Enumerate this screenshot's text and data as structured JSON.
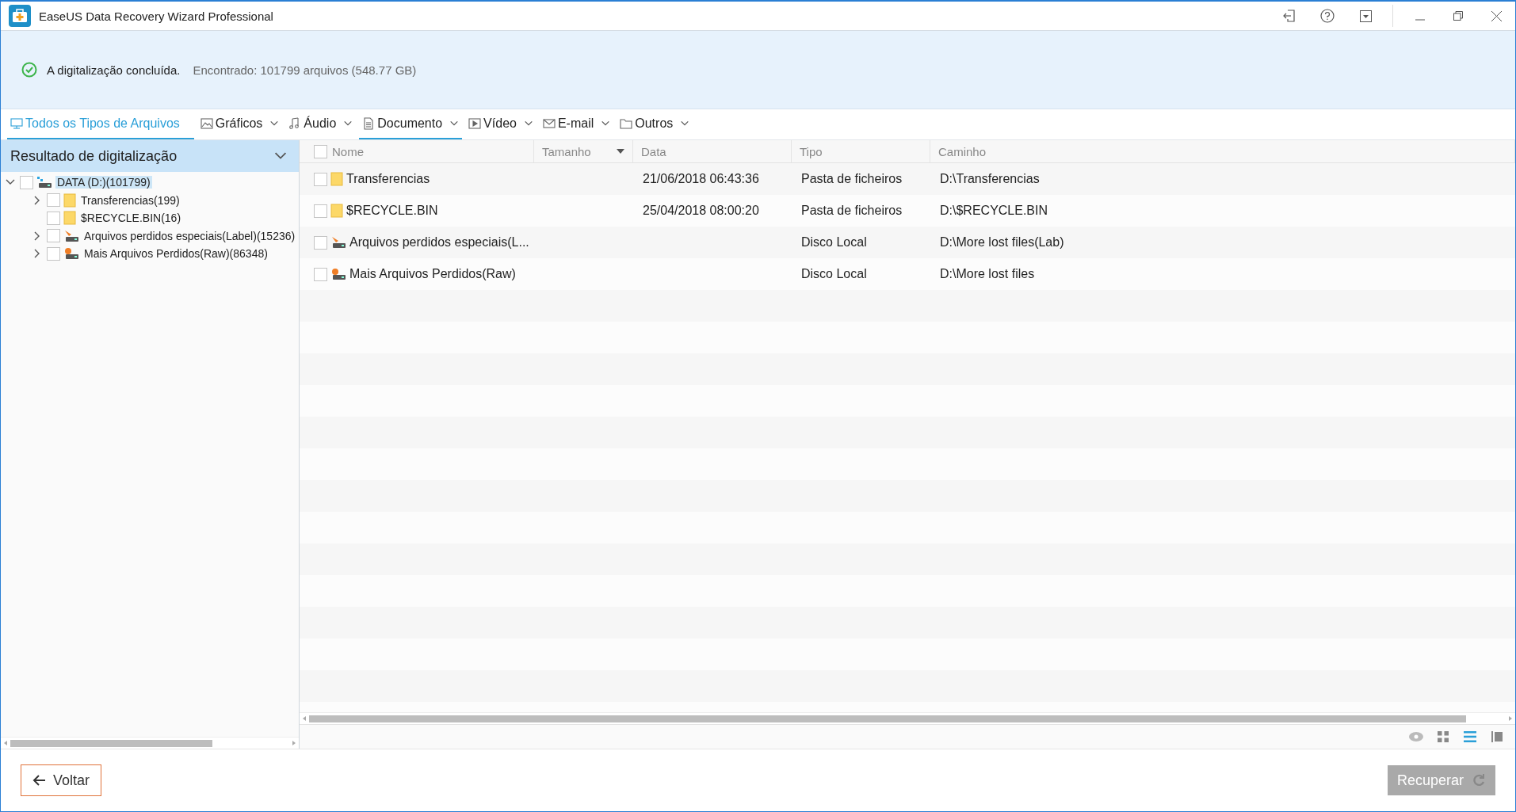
{
  "window": {
    "title": "EaseUS Data Recovery Wizard Professional"
  },
  "status": {
    "message": "A digitalização concluída.",
    "found": "Encontrado: 101799 arquivos (548.77 GB)"
  },
  "tabs": [
    {
      "label": "Todos os Tipos de Arquivos",
      "kind": "monitor",
      "selected": true,
      "underlined": true,
      "dropdown": false
    },
    {
      "label": "Gráficos",
      "kind": "image",
      "selected": false,
      "underlined": false,
      "dropdown": true
    },
    {
      "label": "Áudio",
      "kind": "music",
      "selected": false,
      "underlined": false,
      "dropdown": true
    },
    {
      "label": "Documento",
      "kind": "document",
      "selected": false,
      "underlined": true,
      "dropdown": true
    },
    {
      "label": "Vídeo",
      "kind": "video",
      "selected": false,
      "underlined": false,
      "dropdown": true
    },
    {
      "label": "E-mail",
      "kind": "mail",
      "selected": false,
      "underlined": false,
      "dropdown": true
    },
    {
      "label": "Outros",
      "kind": "folder",
      "selected": false,
      "underlined": false,
      "dropdown": true
    }
  ],
  "sidebar": {
    "title": "Resultado de digitalização",
    "tree": [
      {
        "label": "DATA (D:)(101799)",
        "kind": "drive",
        "checked": false,
        "selected": true,
        "expandable": true,
        "expanded": true,
        "children": [
          {
            "label": "Transferencias(199)",
            "kind": "folder",
            "checked": false,
            "selected": false,
            "expandable": true,
            "expanded": false
          },
          {
            "label": "$RECYCLE.BIN(16)",
            "kind": "folder",
            "checked": false,
            "selected": false,
            "expandable": false
          },
          {
            "label": "Arquivos perdidos especiais(Label)(15236)",
            "kind": "lost-drive",
            "checked": false,
            "selected": false,
            "expandable": true,
            "expanded": false
          },
          {
            "label": "Mais Arquivos Perdidos(Raw)(86348)",
            "kind": "raw-drive",
            "checked": false,
            "selected": false,
            "expandable": true,
            "expanded": false
          }
        ]
      }
    ]
  },
  "table": {
    "all_checked": false,
    "columns": [
      {
        "label": "Nome",
        "sorted": false
      },
      {
        "label": "Tamanho",
        "sorted": true
      },
      {
        "label": "Data",
        "sorted": false
      },
      {
        "label": "Tipo",
        "sorted": false
      },
      {
        "label": "Caminho",
        "sorted": false
      }
    ],
    "rows": [
      {
        "checked": false,
        "kind": "folder",
        "name": "Transferencias",
        "date": "21/06/2018 06:43:36",
        "type": "Pasta de ficheiros",
        "path": "D:\\Transferencias"
      },
      {
        "checked": false,
        "kind": "folder",
        "name": "$RECYCLE.BIN",
        "date": "25/04/2018 08:00:20",
        "type": "Pasta de ficheiros",
        "path": "D:\\$RECYCLE.BIN"
      },
      {
        "checked": false,
        "kind": "lost-drive",
        "name": "Arquivos perdidos especiais(L...",
        "type": "Disco Local",
        "path": "D:\\More lost files(Lab)"
      },
      {
        "checked": false,
        "kind": "raw-drive",
        "name": "Mais Arquivos Perdidos(Raw)",
        "type": "Disco Local",
        "path": "D:\\More lost files"
      }
    ]
  },
  "view_modes": [
    {
      "kind": "preview",
      "selected": false
    },
    {
      "kind": "thumbnails",
      "selected": false
    },
    {
      "kind": "list",
      "selected": true
    },
    {
      "kind": "details",
      "selected": false
    }
  ],
  "buttons": {
    "back": {
      "label": "Voltar"
    },
    "recover": {
      "label": "Recuperar",
      "disabled": true
    }
  }
}
